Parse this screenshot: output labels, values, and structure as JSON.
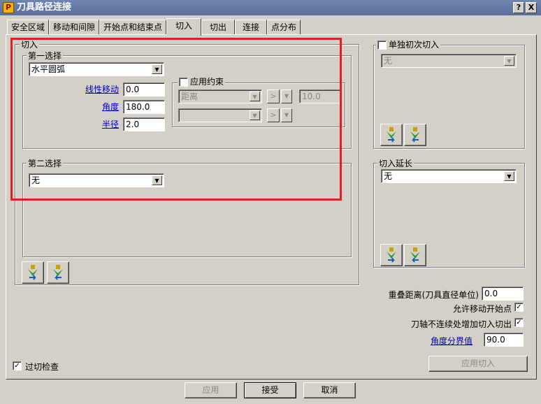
{
  "window": {
    "title": "刀具路径连接",
    "icon_letter": "P",
    "help_label": "?",
    "close_label": "X"
  },
  "tabs": [
    "安全区域",
    "移动和间隙",
    "开始点和结束点",
    "切入",
    "切出",
    "连接",
    "点分布"
  ],
  "active_tab": "切入",
  "lead_in": {
    "group_label": "切入",
    "first_choice": {
      "label": "第一选择",
      "value": "水平圆弧",
      "linear_move_label": "线性移动",
      "linear_move_value": "0.0",
      "angle_label": "角度",
      "angle_value": "180.0",
      "radius_label": "半径",
      "radius_value": "2.0",
      "constraint": {
        "label": "应用约束",
        "checked": false,
        "type_value": "距离",
        "type2_value": "",
        "op_symbol": ">",
        "limit_value": "10.0"
      }
    },
    "second_choice": {
      "label": "第二选择",
      "value": "无"
    }
  },
  "separate_first": {
    "label": "单独初次切入",
    "checked": false,
    "value": "无"
  },
  "extension": {
    "label": "切入延长",
    "value": "无"
  },
  "overlap": {
    "label": "重叠距离(刀具直径单位)",
    "value": "0.0"
  },
  "allow_move_start": {
    "label": "允许移动开始点",
    "checked": true
  },
  "add_on_discontinuity": {
    "label": "刀轴不连续处增加切入切出",
    "checked": true
  },
  "angle_threshold": {
    "label": "角度分界值",
    "value": "90.0"
  },
  "apply_lead_in_label": "应用切入",
  "gouge_check": {
    "label": "过切检查",
    "checked": true
  },
  "footer": {
    "apply_label": "应用",
    "accept_label": "接受",
    "cancel_label": "取消"
  },
  "check_mark": "✓"
}
